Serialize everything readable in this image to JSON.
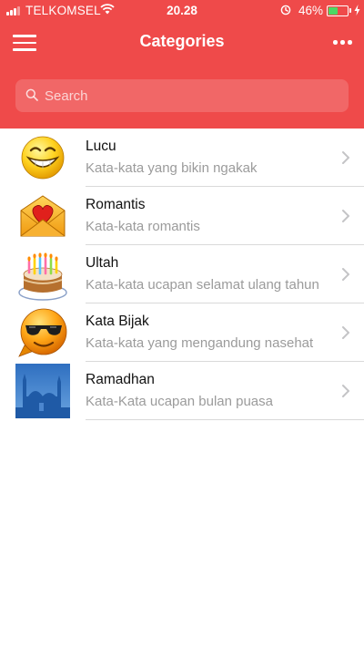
{
  "status_bar": {
    "carrier": "TELKOMSEL",
    "time": "20.28",
    "battery_percent": "46%",
    "battery_level": 0.46,
    "icons": [
      "signal-icon",
      "wifi-icon",
      "location-lock-icon",
      "battery-icon",
      "charging-bolt-icon"
    ]
  },
  "header": {
    "title": "Categories",
    "menu_icon": "hamburger-menu-icon",
    "more_icon": "more-dots-icon",
    "background_color": "#ef4a4a"
  },
  "search": {
    "placeholder": "Search",
    "value": "",
    "icon": "search-icon"
  },
  "categories": [
    {
      "title": "Lucu",
      "subtitle": "Kata-kata yang bikin ngakak",
      "icon": "laughing-smiley-icon"
    },
    {
      "title": "Romantis",
      "subtitle": "Kata-kata romantis",
      "icon": "love-envelope-icon"
    },
    {
      "title": "Ultah",
      "subtitle": "Kata-kata ucapan selamat ulang tahun",
      "icon": "birthday-cake-icon"
    },
    {
      "title": "Kata Bijak",
      "subtitle": "Kata-kata yang mengandung nasehat",
      "icon": "cool-sunglasses-smiley-icon"
    },
    {
      "title": "Ramadhan",
      "subtitle": "Kata-Kata ucapan bulan puasa",
      "icon": "mosque-image-icon"
    }
  ]
}
